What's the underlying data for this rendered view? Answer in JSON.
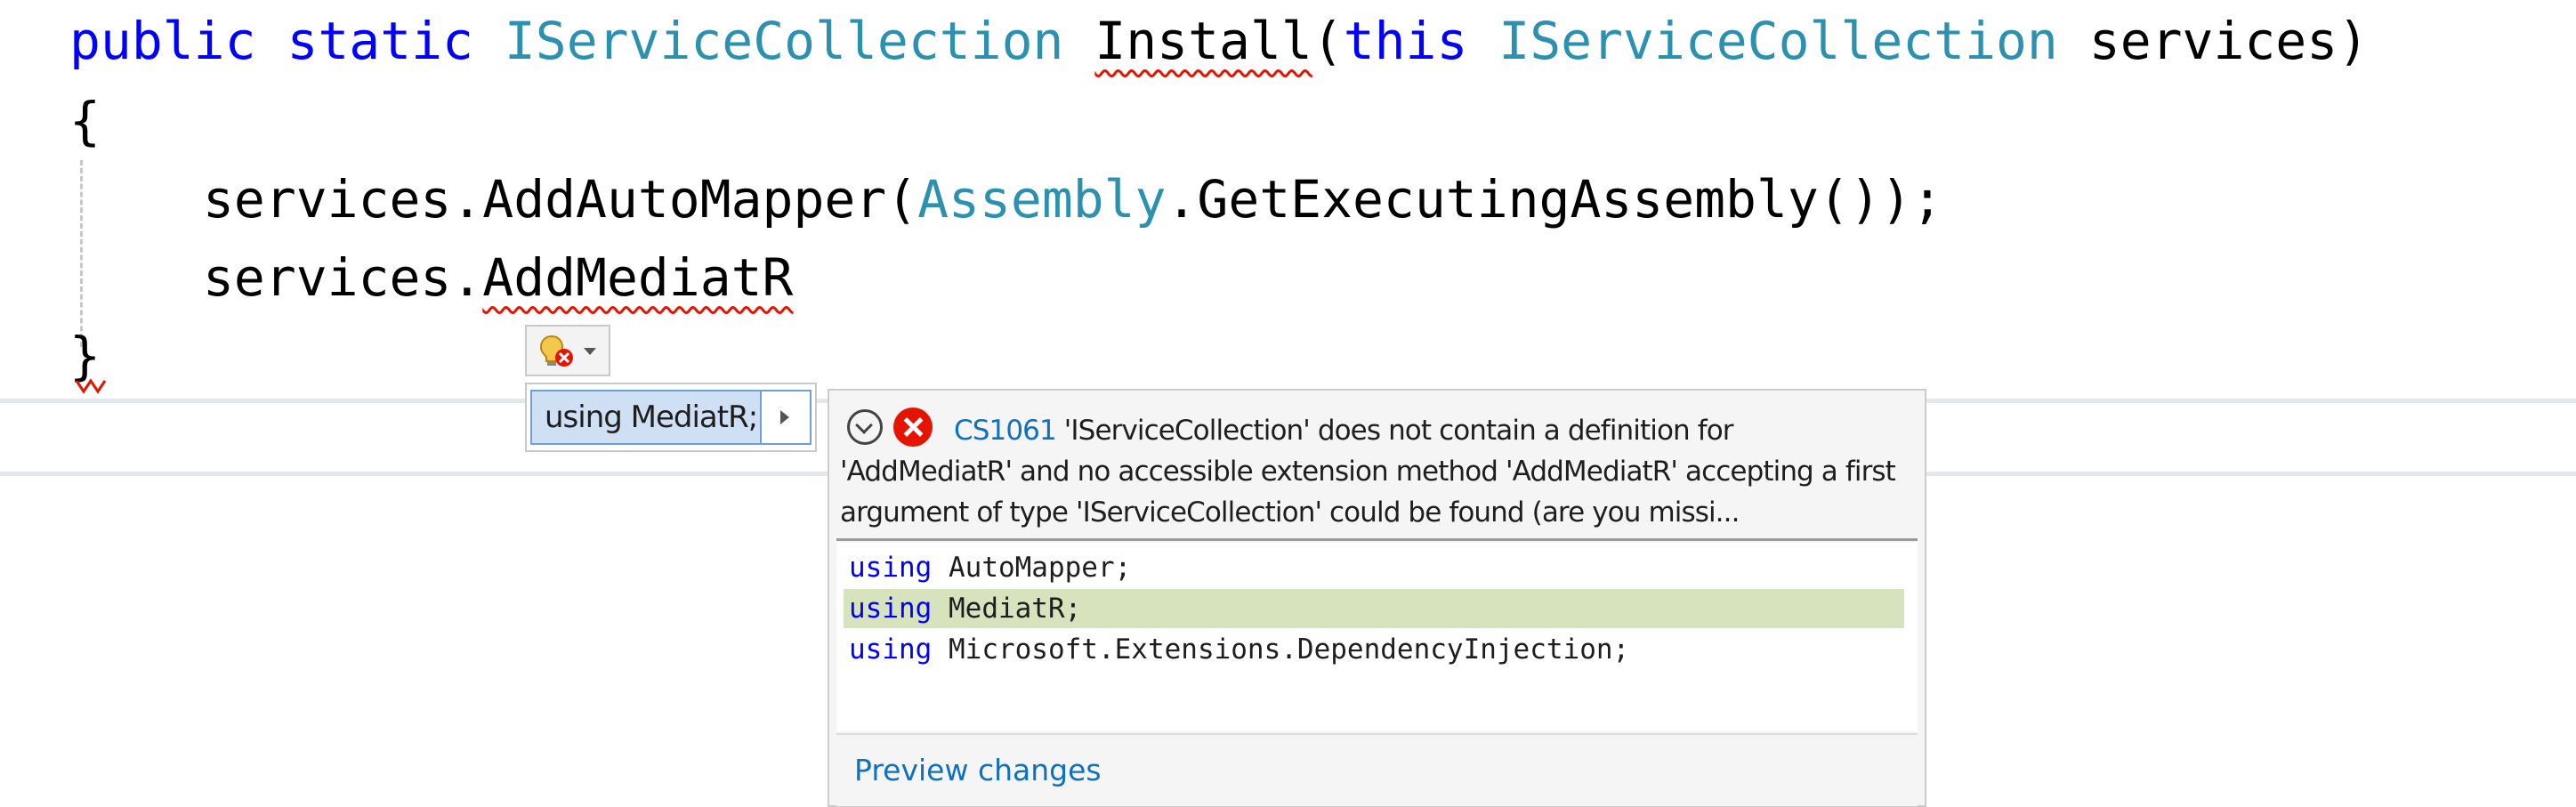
{
  "editor": {
    "line1": {
      "kw_public": "public",
      "kw_static": "static",
      "return_type": "IServiceCollection",
      "method_name": "Install",
      "paren_open": "(",
      "kw_this": "this",
      "param_type": "IServiceCollection",
      "param_name": "services)"
    },
    "line2": {
      "text": "{"
    },
    "line3": {
      "prefix": "services.AddAutoMapper(",
      "type": "Assembly",
      "suffix": ".GetExecutingAssembly());"
    },
    "line4": {
      "prefix": "services.",
      "member": "AddMediatR"
    },
    "line5": {
      "text": "}"
    }
  },
  "lightbulb": {
    "icon": "lightbulb-error-icon"
  },
  "quick_actions": {
    "items": [
      {
        "label": "using MediatR;"
      }
    ]
  },
  "preview": {
    "diagnostic": {
      "code": "CS1061",
      "message": "'IServiceCollection' does not contain a definition for 'AddMediatR' and no accessible extension method 'AddMediatR' accepting a first argument of type 'IServiceCollection' could be found (are you missi..."
    },
    "diff_lines": [
      {
        "kw": "using",
        "ns": " AutoMapper;",
        "added": false
      },
      {
        "kw": "using",
        "ns": " MediatR;",
        "added": true
      },
      {
        "kw": "using",
        "ns": " Microsoft.Extensions.DependencyInjection;",
        "added": false
      }
    ],
    "footer_link": "Preview changes"
  },
  "colors": {
    "keyword": "#0000ff",
    "type": "#2b91af",
    "error": "#e51400",
    "added_line": "#d7e3bd",
    "link": "#0e70c0"
  }
}
